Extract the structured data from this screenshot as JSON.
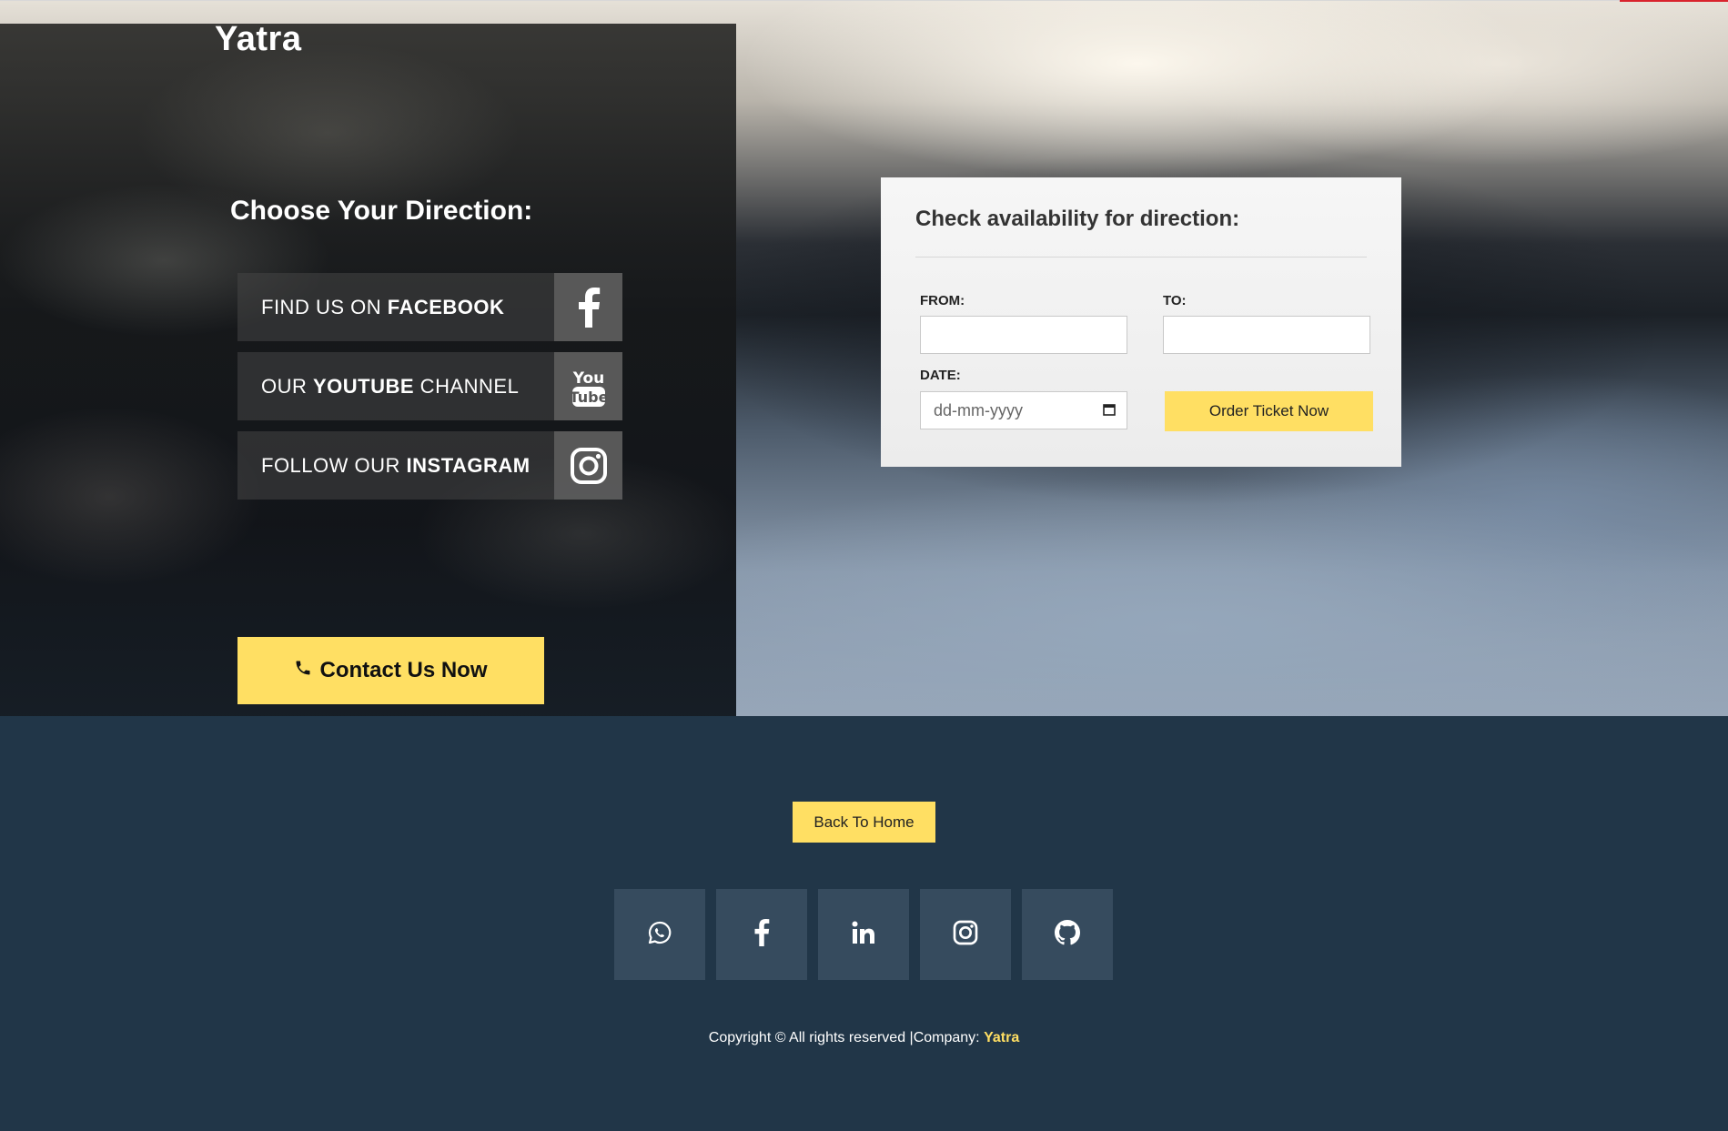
{
  "brand": "Yatra",
  "left": {
    "title": "Choose Your Direction:",
    "social": [
      {
        "pre": "FIND US ON ",
        "bold": "FACEBOOK",
        "post": "",
        "icon": "facebook-icon"
      },
      {
        "pre": "OUR ",
        "bold": "YOUTUBE",
        "post": " CHANNEL",
        "icon": "youtube-icon"
      },
      {
        "pre": "FOLLOW OUR ",
        "bold": "INSTAGRAM",
        "post": "",
        "icon": "instagram-icon"
      }
    ],
    "contact_label": "Contact Us Now",
    "contact_icon": "phone-icon"
  },
  "form": {
    "title": "Check availability for direction:",
    "from_label": "FROM:",
    "from_value": "",
    "to_label": "TO:",
    "to_value": "",
    "date_label": "DATE:",
    "date_placeholder": "dd-mm-yyyy",
    "submit_label": "Order Ticket Now"
  },
  "footer": {
    "home_label": "Back To Home",
    "icons": [
      "whatsapp-icon",
      "facebook-icon",
      "linkedin-icon",
      "instagram-icon",
      "github-icon"
    ],
    "copyright": "Copyright © All rights reserved  |Company: ",
    "company": "Yatra"
  },
  "colors": {
    "accent": "#ffdf63",
    "footer_bg": "#213648",
    "icon_tile": "#364b5e"
  }
}
